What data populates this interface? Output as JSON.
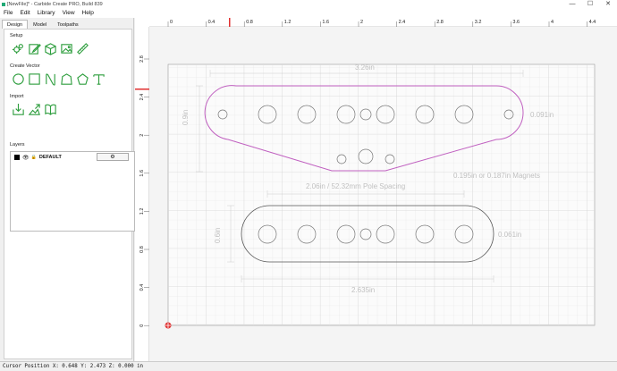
{
  "window": {
    "title": "[NewFile]* - Carbide Create PRO, Build 839",
    "minimize": "—",
    "maximize": "☐",
    "close": "✕"
  },
  "menu": [
    "File",
    "Edit",
    "Library",
    "View",
    "Help"
  ],
  "tabs": [
    "Design",
    "Model",
    "Toolpaths"
  ],
  "sections": {
    "setup": "Setup",
    "create_vector": "Create Vector",
    "import": "Import",
    "layers": "Layers"
  },
  "setup_icons": [
    "job-setup-icon",
    "edit-icon",
    "box-icon",
    "image-icon",
    "ruler-icon"
  ],
  "vector_icons": [
    "circle-icon",
    "rectangle-icon",
    "curve-icon",
    "polygon-blob-icon",
    "pentagon-icon",
    "text-icon"
  ],
  "import_icons": [
    "import-arrow-icon",
    "import-image-icon",
    "library-book-icon"
  ],
  "layer": {
    "name": "DEFAULT",
    "gear": "⚙",
    "color": "#000000"
  },
  "ruler": {
    "x_ticks": [
      "0",
      "0.4",
      "0.8",
      "1.2",
      "1.6",
      "2",
      "2.4",
      "2.8",
      "3.2",
      "3.6",
      "4",
      "4.4"
    ],
    "y_ticks": [
      "2.8",
      "2.4",
      "2",
      "1.6",
      "1.2",
      "0.8",
      "0.4",
      "0"
    ]
  },
  "dimensions": {
    "top_width": "3.26in",
    "top_height": "0.9in",
    "top_right_hole": "0.091in",
    "magnets": "0.195in or 0.187in Magnets",
    "pole_spacing": "2.06in / 52.32mm Pole Spacing",
    "bottom_height": "0.6in",
    "bottom_right_hole": "0.061in",
    "bottom_width": "2.635in"
  },
  "colors": {
    "accent": "#2e9e3e",
    "selection": "#c060c0",
    "outline": "#555555",
    "cursor": "#e03030"
  },
  "status": "Cursor Position X: 0.648 Y: 2.473 Z: 0.000 in"
}
